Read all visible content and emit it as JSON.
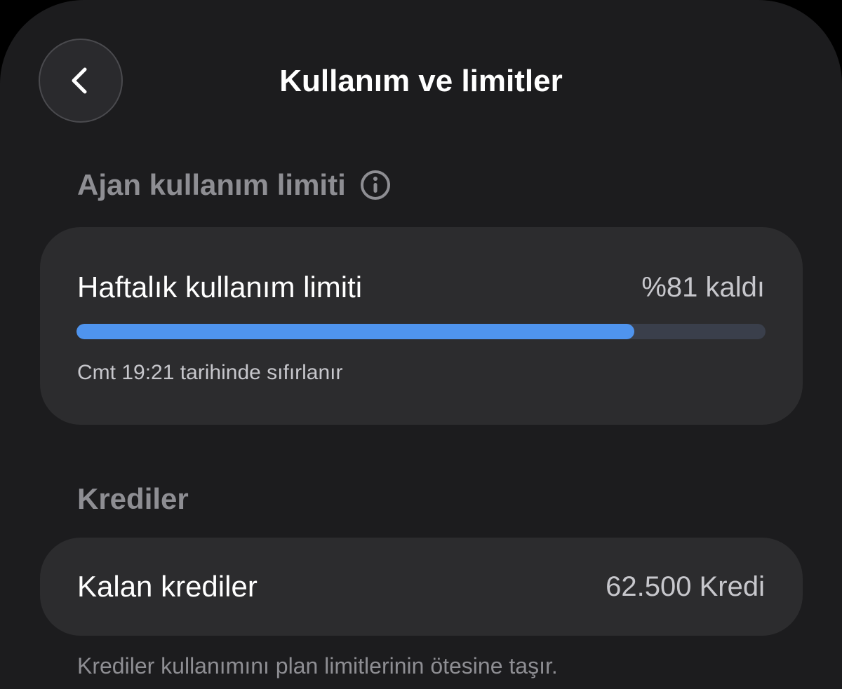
{
  "header": {
    "title": "Kullanım ve limitler",
    "back_icon": "chevron-left-icon"
  },
  "agent_usage": {
    "section_title": "Ajan kullanım limiti",
    "info_icon": "info-circle-icon",
    "weekly": {
      "label": "Haftalık kullanım limiti",
      "value_text": "%81 kaldı",
      "remaining_fraction": 0.81,
      "reset_text": "Cmt 19:21 tarihinde sıfırlanır"
    }
  },
  "credits": {
    "section_title": "Krediler",
    "remaining_label": "Kalan krediler",
    "remaining_value": "62.500 Kredi",
    "footnote": "Krediler kullanımını plan limitlerinin ötesine taşır."
  },
  "colors": {
    "background": "#1c1c1e",
    "card": "#2c2c2e",
    "accent_progress": "#4f94ee",
    "progress_track": "#3a3f4b",
    "secondary_text": "#8e8e93"
  }
}
